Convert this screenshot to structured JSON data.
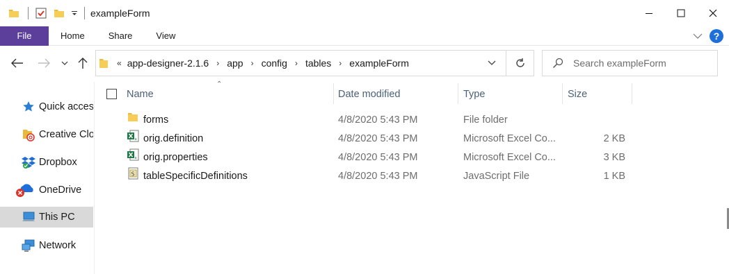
{
  "window": {
    "title": "exampleForm",
    "qat_icons": [
      "folder-icon",
      "properties-checkbox-icon",
      "new-folder-icon",
      "qat-dropdown-icon"
    ]
  },
  "ribbon": {
    "tabs": [
      {
        "label": "File",
        "active": true
      },
      {
        "label": "Home"
      },
      {
        "label": "Share"
      },
      {
        "label": "View"
      }
    ],
    "accent": "#5b3f9a",
    "help_label": "?"
  },
  "address": {
    "overflow_glyph": "«",
    "crumbs": [
      "app-designer-2.1.6",
      "app",
      "config",
      "tables",
      "exampleForm"
    ]
  },
  "search": {
    "placeholder": "Search exampleForm"
  },
  "sidebar": {
    "items": [
      {
        "label": "Quick access",
        "icon": "star-icon"
      },
      {
        "label": "Creative Cloud Files",
        "icon": "creative-cloud-icon"
      },
      {
        "label": "Dropbox",
        "icon": "dropbox-icon"
      },
      {
        "label": "OneDrive",
        "icon": "onedrive-icon"
      },
      {
        "label": "This PC",
        "icon": "computer-icon",
        "selected": true
      },
      {
        "label": "Network",
        "icon": "network-icon"
      }
    ]
  },
  "columns": {
    "name": "Name",
    "date": "Date modified",
    "type": "Type",
    "size": "Size"
  },
  "files": [
    {
      "name": "forms",
      "date": "4/8/2020 5:43 PM",
      "type": "File folder",
      "size": "",
      "icon": "folder-icon"
    },
    {
      "name": "orig.definition",
      "date": "4/8/2020 5:43 PM",
      "type": "Microsoft Excel Co...",
      "size": "2 KB",
      "icon": "excel-csv-icon"
    },
    {
      "name": "orig.properties",
      "date": "4/8/2020 5:43 PM",
      "type": "Microsoft Excel Co...",
      "size": "3 KB",
      "icon": "excel-csv-icon"
    },
    {
      "name": "tableSpecificDefinitions",
      "date": "4/8/2020 5:43 PM",
      "type": "JavaScript File",
      "size": "1 KB",
      "icon": "javascript-file-icon"
    }
  ]
}
